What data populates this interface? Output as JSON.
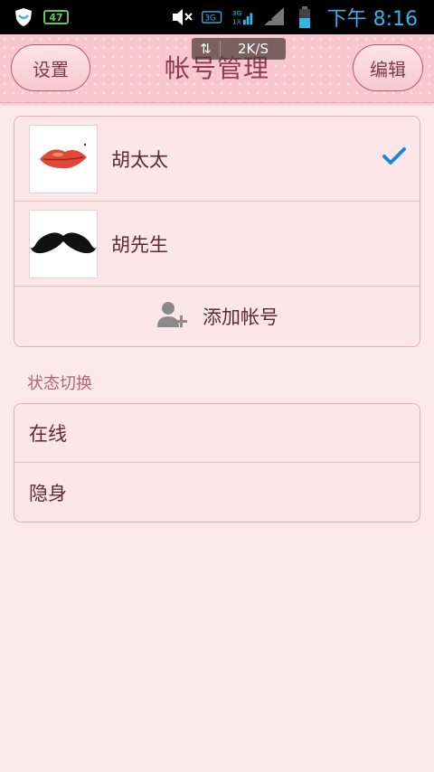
{
  "status_bar": {
    "battery_badge": "47",
    "time": "下午 8:16",
    "net_speed": "2K/S",
    "icons": [
      "shield-icon",
      "mute-icon",
      "3g-signal-icon",
      "sim-unknown-icon",
      "battery-icon"
    ]
  },
  "header": {
    "title": "帐号管理",
    "settings_label": "设置",
    "edit_label": "编辑"
  },
  "accounts": [
    {
      "name": "胡太太",
      "avatar": "lips-icon",
      "selected": true
    },
    {
      "name": "胡先生",
      "avatar": "mustache-icon",
      "selected": false
    }
  ],
  "add_account_label": "添加帐号",
  "status_section": {
    "label": "状态切换",
    "options": [
      "在线",
      "隐身"
    ]
  },
  "colors": {
    "header_bg": "#f9c5cf",
    "page_bg": "#fde9ec",
    "accent_text": "#8d3a4b",
    "check": "#1e88d8"
  }
}
